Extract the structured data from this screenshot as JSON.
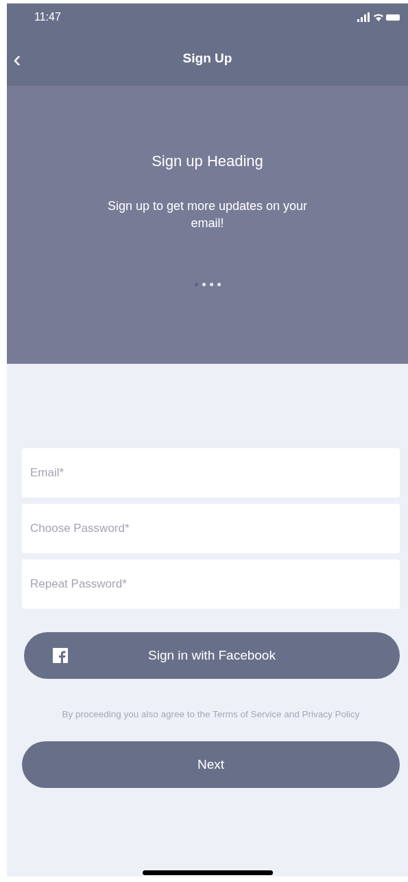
{
  "status_bar": {
    "time": "11:47"
  },
  "nav_bar": {
    "back": "‹",
    "title": "Sign Up"
  },
  "hero": {
    "heading": "Sign up Heading",
    "subtitle": "Sign up to get more updates on your email!",
    "pages": [
      {
        "selected": true
      },
      {
        "selected": false
      },
      {
        "selected": false
      },
      {
        "selected": false
      }
    ]
  },
  "fields": [
    {
      "placeholder": "Email*"
    },
    {
      "placeholder": "Choose Password*"
    },
    {
      "placeholder": "Repeat Password*"
    }
  ],
  "facebook_button": {
    "label": "Sign in with Facebook"
  },
  "terms": "By proceeding you also agree to the Terms of Service and Privacy Policy",
  "next_button": {
    "label": "Next"
  }
}
